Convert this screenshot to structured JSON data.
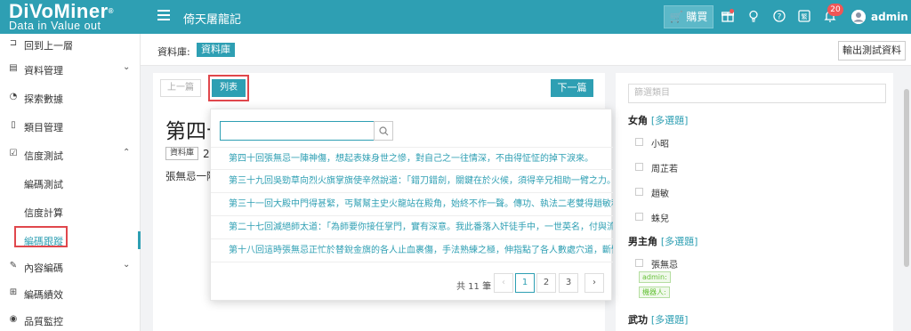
{
  "header": {
    "logo_main": "DiVoMiner",
    "logo_sub": "Data in  Value out",
    "project_title": "倚天屠龍記",
    "buy_label": "購買",
    "notification_count": "20",
    "username": "admin"
  },
  "sidebar": {
    "back": "回到上一層",
    "data_mgmt": "資料管理",
    "explore": "探索數據",
    "category_mgmt": "類目管理",
    "reliability": "信度測試",
    "coding_test": "編碼測試",
    "reliability_calc": "信度計算",
    "coding_trace": "編碼跟蹤",
    "content_coding": "內容編碼",
    "coding_perf": "編碼績效",
    "quality": "品質監控"
  },
  "breadcrumb": {
    "label": "資料庫:",
    "tag": "資料庫",
    "export": "輸出測試資料"
  },
  "doc": {
    "prev": "上一篇",
    "list": "列表",
    "next": "下一篇",
    "title": "第四十回張無忌",
    "tag": "資料庫",
    "date": "2",
    "body": "張無忌一陣"
  },
  "popup": {
    "results": [
      "第四十回張無忌一陣神傷，想起表妹身世之慘，對自己之一往情深，不由得怔怔的掉下淚來。",
      "第三十九回吳勁草向烈火旗掌旗使辛然說道：「錯刀錯劍，關鍵在於火候，須得辛兄相助一臂之力。...",
      "第三十一回大殿中門得甚緊，丐幫幫主史火龍站在殿角，始終不作一聲。傳功、執法二老雙得趙敏和...",
      "第二十七回滅絕師太道：「為師要你接任掌門，實有深意。我此番落入奸徒手中，一世英名，付與流...",
      "第十八回這時張無忌正忙於替銳金旗的各人止血裹傷，手法熟練之極，伸指點了各人數處穴道，斷臂..."
    ],
    "total": "共 11 筆",
    "pages": [
      "1",
      "2",
      "3"
    ],
    "prev_icon": "‹",
    "next_icon": "›"
  },
  "right": {
    "filter_placeholder": "篩選類目",
    "female_title": "女角",
    "multi": "[多選題]",
    "female": [
      "小昭",
      "周芷若",
      "趙敏",
      "蛛兒"
    ],
    "male_title": "男主角",
    "male": [
      "張無忌"
    ],
    "tag_admin": "admin:",
    "tag_robot": "機器人:",
    "martial_title": "武功"
  }
}
